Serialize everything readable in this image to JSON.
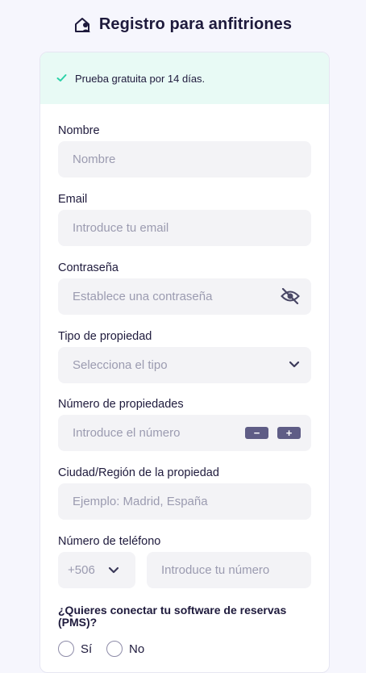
{
  "header": {
    "title": "Registro para anfitriones",
    "icon": "house-user-icon"
  },
  "trial": {
    "text": "Prueba gratuita por 14 días.",
    "icon": "check-icon",
    "color": "#2bd1a7"
  },
  "fields": {
    "nombre": {
      "label": "Nombre",
      "placeholder": "Nombre"
    },
    "email": {
      "label": "Email",
      "placeholder": "Introduce tu email"
    },
    "password": {
      "label": "Contraseña",
      "placeholder": "Establece una contraseña",
      "icon": "eye-off-icon"
    },
    "tipo": {
      "label": "Tipo de propiedad",
      "placeholder": "Selecciona el tipo",
      "icon": "chevron-down-icon"
    },
    "numero": {
      "label": "Número de propiedades",
      "placeholder": "Introduce el número",
      "minus": "−",
      "plus": "+"
    },
    "ciudad": {
      "label": "Ciudad/Región de la propiedad",
      "placeholder": "Ejemplo: Madrid, España"
    },
    "telefono": {
      "label": "Número de teléfono",
      "prefix": "+506",
      "placeholder": "Introduce tu número"
    }
  },
  "pms": {
    "question": "¿Quieres conectar tu software de reservas (PMS)?",
    "options": [
      "Sí",
      "No"
    ]
  },
  "colors": {
    "accent": "#5f5d86",
    "text": "#1e1a3c",
    "input_bg": "#f3f3f6",
    "placeholder": "#9b9bb0"
  }
}
